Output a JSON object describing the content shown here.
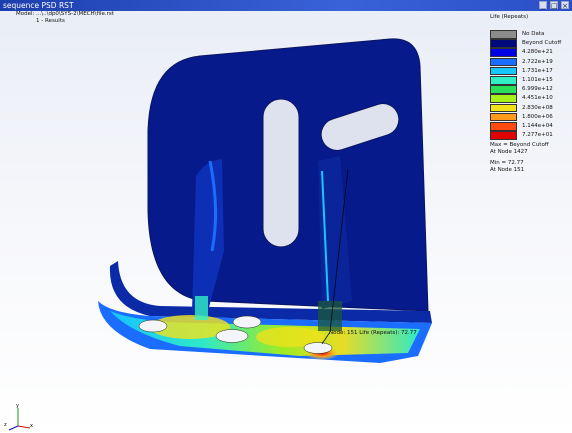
{
  "window": {
    "title": "sequence PSD RST",
    "controls": [
      "_",
      "□",
      "×"
    ]
  },
  "model_info": {
    "model_label": "Model:",
    "model_value": "...\\..\\dp0\\SYS-2\\MECH\\file.rst",
    "result_label": "1 - Results"
  },
  "legend": {
    "title": "Life (Repeats)",
    "entries": [
      {
        "label": "No Data",
        "color": "#8c8c8c"
      },
      {
        "label": "Beyond Cutoff",
        "color": "#000a7a"
      },
      {
        "label": "4.280e+21",
        "color": "#0000e6"
      },
      {
        "label": "2.722e+19",
        "color": "#1a6dff"
      },
      {
        "label": "1.731e+17",
        "color": "#17c7ff"
      },
      {
        "label": "1.101e+15",
        "color": "#2ff0c4"
      },
      {
        "label": "6.999e+12",
        "color": "#29e05a"
      },
      {
        "label": "4.451e+10",
        "color": "#a4f21a"
      },
      {
        "label": "2.830e+08",
        "color": "#f2e21a"
      },
      {
        "label": "1.800e+06",
        "color": "#ff9a1a"
      },
      {
        "label": "1.144e+04",
        "color": "#ff4a10"
      },
      {
        "label": "7.277e+01",
        "color": "#e00000"
      }
    ],
    "max_line": "Max = Beyond Cutoff",
    "max_node": "At Node 1427",
    "min_line": "Min = 72.77",
    "min_node": "At Node 151"
  },
  "annotation": {
    "text": "Node: 151 Life (Repeats): 72.77"
  },
  "triad": {
    "x": "x",
    "y": "y",
    "z": "z"
  }
}
